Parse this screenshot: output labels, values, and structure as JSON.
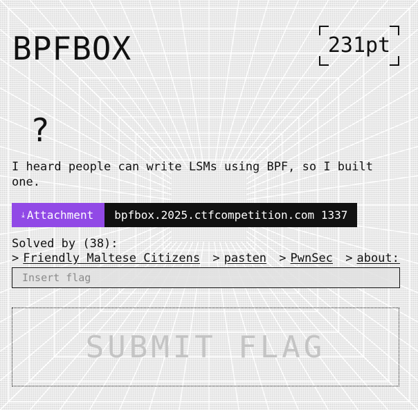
{
  "challenge": {
    "title": "BPFBOX",
    "points": "231pt",
    "category_glyph": "?",
    "description": "I heard people can write LSMs using BPF, so I built one."
  },
  "attachment": {
    "icon": "download-icon",
    "icon_glyph": "⤓",
    "label": "Attachment",
    "server": "bpfbox.2025.ctfcompetition.com 1337"
  },
  "solves": {
    "label": "Solved by (38):",
    "separator": ">",
    "teams": [
      "Friendly Maltese Citizens",
      "pasten",
      "PwnSec",
      "about:b"
    ]
  },
  "flag_form": {
    "placeholder": "Insert flag",
    "value": "",
    "submit_label": "SUBMIT FLAG"
  },
  "colors": {
    "accent": "#9149e6",
    "dark": "#111111",
    "background": "#e9e9e9",
    "submit_text": "#c4c4c4"
  }
}
